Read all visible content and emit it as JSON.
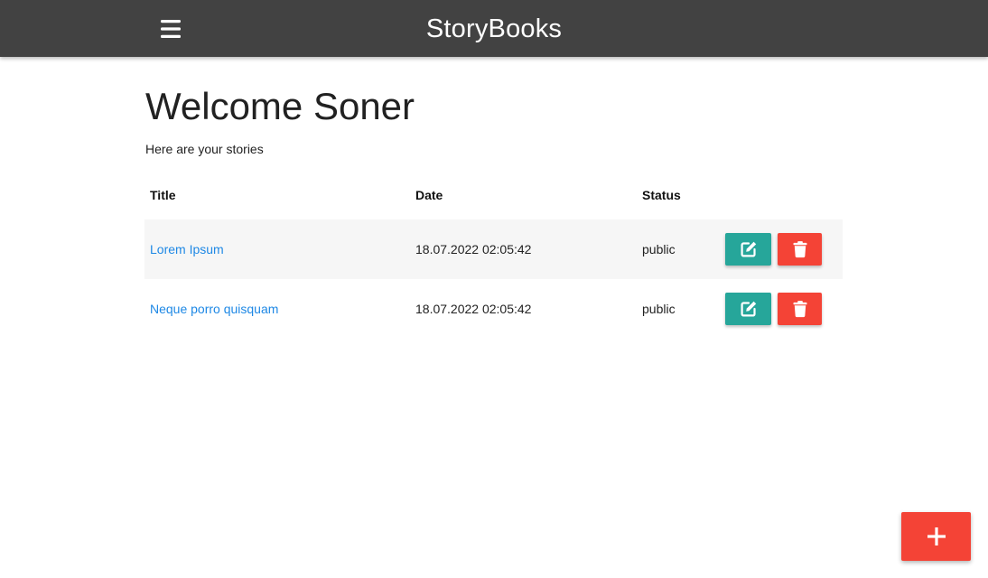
{
  "navbar": {
    "brand": "StoryBooks",
    "menu_icon": "hamburger-menu-icon",
    "background_color": "#424242"
  },
  "page": {
    "title": "Welcome Soner",
    "subtitle": "Here are your stories"
  },
  "table": {
    "headers": {
      "title": "Title",
      "date": "Date",
      "status": "Status"
    },
    "rows": [
      {
        "title": "Lorem Ipsum",
        "date": "18.07.2022 02:05:42",
        "status": "public",
        "edit_icon": "edit-icon",
        "delete_icon": "trash-icon"
      },
      {
        "title": "Neque porro quisquam",
        "date": "18.07.2022 02:05:42",
        "status": "public",
        "edit_icon": "edit-icon",
        "delete_icon": "trash-icon"
      }
    ]
  },
  "fab": {
    "icon": "plus-icon"
  },
  "colors": {
    "link": "#1e88e5",
    "edit_button": "#26a69a",
    "delete_button": "#f44336",
    "add_button": "#f44336"
  }
}
